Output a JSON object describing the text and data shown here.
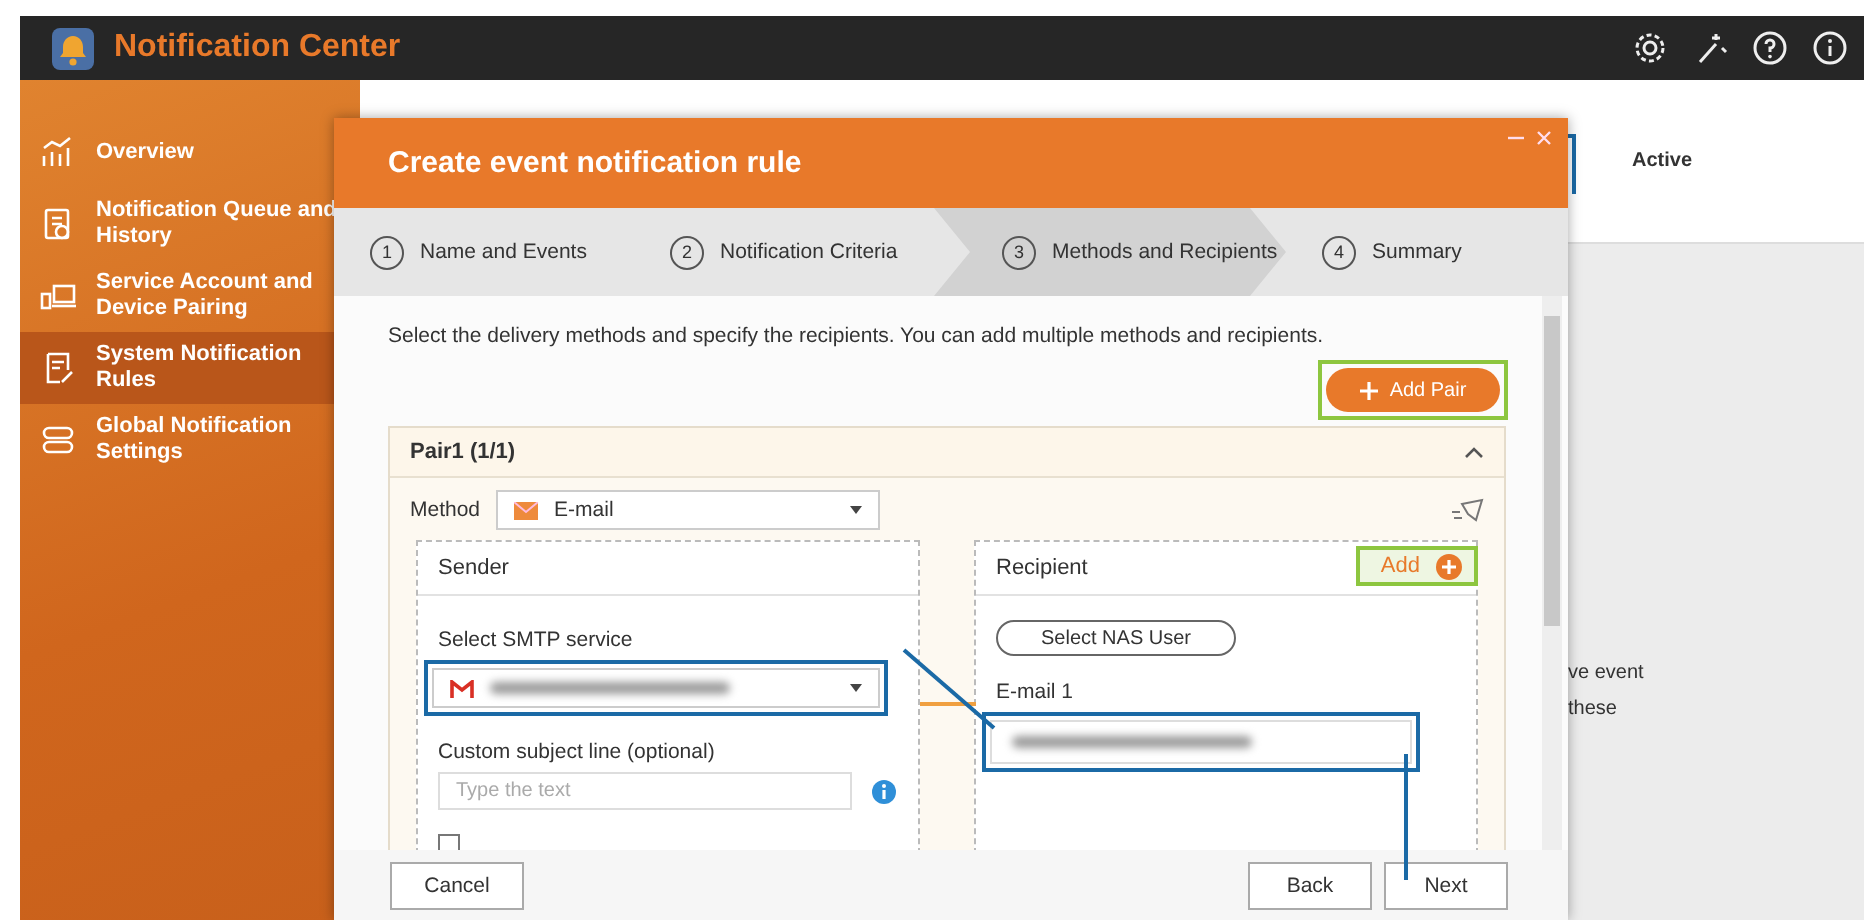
{
  "app": {
    "title": "Notification Center"
  },
  "sidebar": {
    "items": [
      {
        "label": "Overview",
        "selected": false
      },
      {
        "label": "Notification Queue and History",
        "selected": false
      },
      {
        "label": "Service Account and Device Pairing",
        "selected": false
      },
      {
        "label": "System Notification Rules",
        "selected": true
      },
      {
        "label": "Global Notification Settings",
        "selected": false
      }
    ]
  },
  "background": {
    "column_header": "Active",
    "text_fragments": [
      "ve event",
      "these"
    ]
  },
  "dialog": {
    "title": "Create event notification rule",
    "steps": [
      {
        "number": "1",
        "label": "Name and Events",
        "selected": false
      },
      {
        "number": "2",
        "label": "Notification Criteria",
        "selected": false
      },
      {
        "number": "3",
        "label": "Methods and Recipients",
        "selected": true
      },
      {
        "number": "4",
        "label": "Summary",
        "selected": false
      }
    ],
    "instructions": "Select the delivery methods and specify the recipients. You can add multiple methods and recipients.",
    "add_pair": "Add Pair",
    "pair": {
      "title": "Pair1 (1/1)",
      "expanded": true,
      "method_label": "Method",
      "method_value": "E-mail",
      "sender": {
        "title": "Sender",
        "smtp_label": "Select SMTP service",
        "subject_label": "Custom subject line (optional)",
        "subject_placeholder": "Type the text",
        "plain_text_checked": false
      },
      "recipient": {
        "title": "Recipient",
        "add": "Add",
        "select_user": "Select NAS User",
        "email_label": "E-mail 1"
      }
    },
    "buttons": {
      "cancel": "Cancel",
      "back": "Back",
      "next": "Next"
    }
  }
}
